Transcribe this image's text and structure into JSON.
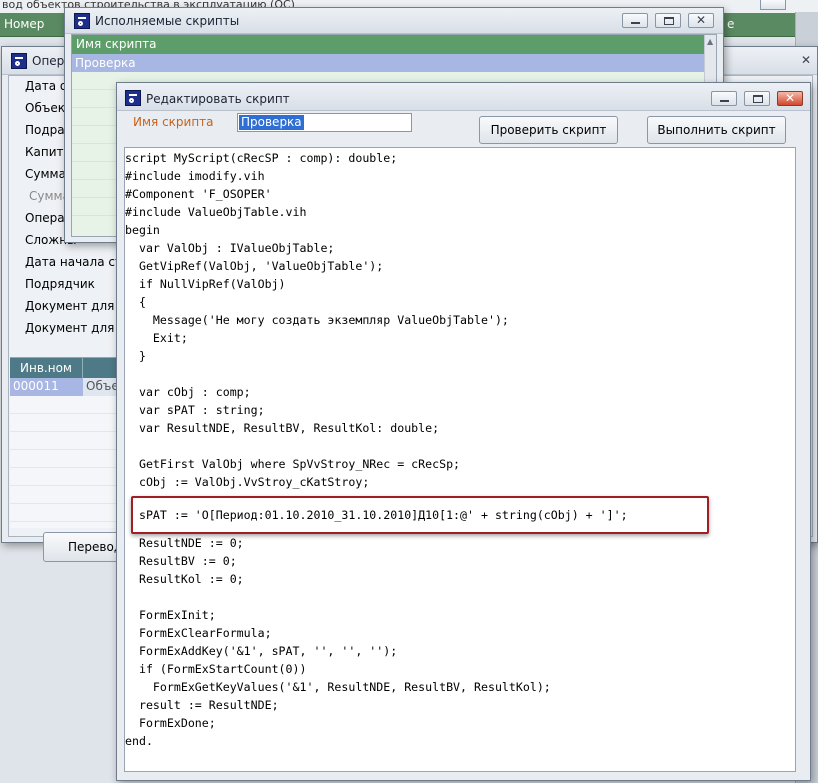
{
  "background": {
    "strip_text": "вод объектов строительства в эксплуатацию (ОС)",
    "header_left": "Номер",
    "header_right": "е"
  },
  "operations_window": {
    "title": "Опера",
    "fields": [
      "Дата оп",
      "Объект",
      "Подразд",
      "Капитал",
      "Сумма о",
      "Сумма о",
      "Операци",
      "Сложны",
      "Дата начала стр",
      "Подрядчик",
      "Документ для уч",
      "Документ для уч"
    ],
    "grid": {
      "columns": [
        "Инв.ном",
        ""
      ],
      "rows": [
        [
          "000011",
          "Объе"
        ]
      ]
    },
    "button": "Перевод"
  },
  "scripts_window": {
    "title": "Исполняемые скрипты",
    "column": "Имя скрипта",
    "rows": [
      "Проверка"
    ]
  },
  "editor_window": {
    "title": "Редактировать скрипт",
    "name_label": "Имя скрипта",
    "name_value": "Проверка",
    "check_button": "Проверить скрипт",
    "run_button": "Выполнить скрипт",
    "code_lines": [
      "script MyScript(cRecSP : comp): double;",
      "#include imodify.vih",
      "#Component 'F_OSOPER'",
      "#include ValueObjTable.vih",
      "begin",
      "  var ValObj : IValueObjTable;",
      "  GetVipRef(ValObj, 'ValueObjTable');",
      "  if NullVipRef(ValObj)",
      "  {",
      "    Message('Не могу создать экземпляр ValueObjTable');",
      "    Exit;",
      "  }",
      "",
      "  var cObj : comp;",
      "  var sPAT : string;",
      "  var ResultNDE, ResultBV, ResultKol: double;",
      "",
      "  GetFirst ValObj where SpVvStroy_NRec = cRecSp;",
      "  cObj := ValObj.VvStroy_cKatStroy;",
      "",
      "  sPAT := 'О[Период:01.10.2010_31.10.2010]Д10[1:@' + string(cObj) + ']';",
      "",
      "  ResultNDE := 0;",
      "  ResultBV := 0;",
      "  ResultKol := 0;",
      "",
      "  FormExInit;",
      "  FormExClearFormula;",
      "  FormExAddKey('&1', sPAT, '', '', '');",
      "  if (FormExStartCount(0))",
      "    FormExGetKeyValues('&1', ResultNDE, ResultBV, ResultKol);",
      "  result := ResultNDE;",
      "  FormExDone;",
      "end."
    ]
  },
  "colors": {
    "accent_green": "#5d9d6a",
    "selection_blue": "#a8b6e3",
    "highlight_red": "#a01e24",
    "label_orange": "#c8621a"
  }
}
